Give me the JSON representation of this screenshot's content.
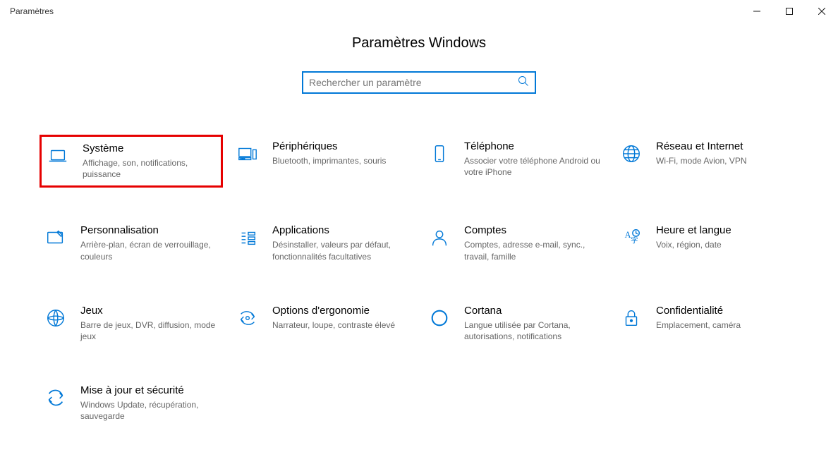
{
  "window": {
    "title": "Paramètres"
  },
  "page": {
    "title": "Paramètres Windows"
  },
  "search": {
    "placeholder": "Rechercher un paramètre"
  },
  "tiles": {
    "system": {
      "title": "Système",
      "desc": "Affichage, son, notifications, puissance"
    },
    "devices": {
      "title": "Périphériques",
      "desc": "Bluetooth, imprimantes, souris"
    },
    "phone": {
      "title": "Téléphone",
      "desc": "Associer votre téléphone Android ou votre iPhone"
    },
    "network": {
      "title": "Réseau et Internet",
      "desc": "Wi-Fi, mode Avion, VPN"
    },
    "personalization": {
      "title": "Personnalisation",
      "desc": "Arrière-plan, écran de verrouillage, couleurs"
    },
    "apps": {
      "title": "Applications",
      "desc": "Désinstaller, valeurs par défaut, fonctionnalités facultatives"
    },
    "accounts": {
      "title": "Comptes",
      "desc": "Comptes, adresse e-mail, sync., travail, famille"
    },
    "time": {
      "title": "Heure et langue",
      "desc": "Voix, région, date"
    },
    "gaming": {
      "title": "Jeux",
      "desc": "Barre de jeux, DVR, diffusion, mode jeux"
    },
    "ease": {
      "title": "Options d'ergonomie",
      "desc": "Narrateur, loupe, contraste élevé"
    },
    "cortana": {
      "title": "Cortana",
      "desc": "Langue utilisée par Cortana, autorisations, notifications"
    },
    "privacy": {
      "title": "Confidentialité",
      "desc": "Emplacement, caméra"
    },
    "update": {
      "title": "Mise à jour et sécurité",
      "desc": "Windows Update, récupération, sauvegarde"
    }
  }
}
